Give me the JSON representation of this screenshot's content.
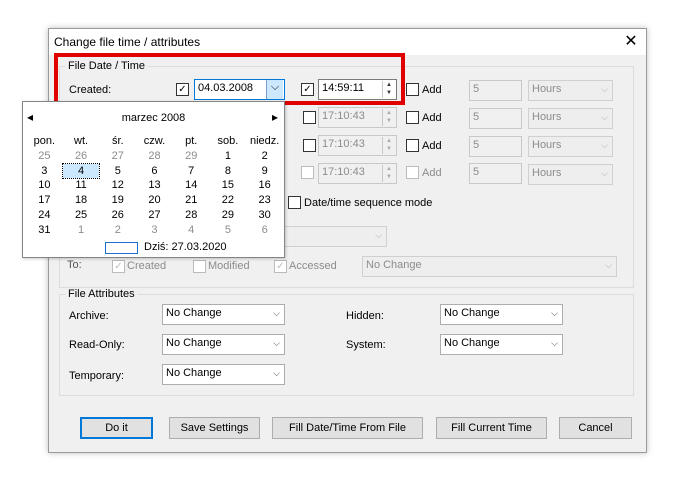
{
  "window": {
    "title": "Change file time / attributes",
    "close_glyph": "✕"
  },
  "file_date_time": {
    "group_label": "File Date / Time",
    "created": {
      "label": "Created:",
      "date": "04.03.2008",
      "time": "14:59:11",
      "add_label": "Add",
      "add_value": "5",
      "unit": "Hours"
    },
    "rows": [
      {
        "time": "17:10:43",
        "add_label": "Add",
        "add_value": "5",
        "unit": "Hours"
      },
      {
        "time": "17:10:43",
        "add_label": "Add",
        "add_value": "5",
        "unit": "Hours"
      },
      {
        "time": "17:10:43",
        "add_label": "Add",
        "add_value": "5",
        "unit": "Hours"
      }
    ],
    "sequence_mode_label": "Date/time sequence mode",
    "to": {
      "label": "To:",
      "created": "Created",
      "modified": "Modified",
      "accessed": "Accessed",
      "combo": "No Change"
    }
  },
  "calendar": {
    "month": "marzec 2008",
    "prev": "◂",
    "next": "▸",
    "weekdays": [
      "pon.",
      "wt.",
      "śr.",
      "czw.",
      "pt.",
      "sob.",
      "niedz."
    ],
    "days": [
      [
        "25",
        "26",
        "27",
        "28",
        "29",
        "1",
        "2"
      ],
      [
        "3",
        "4",
        "5",
        "6",
        "7",
        "8",
        "9"
      ],
      [
        "10",
        "11",
        "12",
        "13",
        "14",
        "15",
        "16"
      ],
      [
        "17",
        "18",
        "19",
        "20",
        "21",
        "22",
        "23"
      ],
      [
        "24",
        "25",
        "26",
        "27",
        "28",
        "29",
        "30"
      ],
      [
        "31",
        "1",
        "2",
        "3",
        "4",
        "5",
        "6"
      ]
    ],
    "today": "Dziś: 27.03.2020"
  },
  "file_attributes": {
    "group_label": "File Attributes",
    "archive": {
      "label": "Archive:",
      "value": "No Change"
    },
    "read_only": {
      "label": "Read-Only:",
      "value": "No Change"
    },
    "temporary": {
      "label": "Temporary:",
      "value": "No Change"
    },
    "hidden": {
      "label": "Hidden:",
      "value": "No Change"
    },
    "system": {
      "label": "System:",
      "value": "No Change"
    }
  },
  "buttons": {
    "do_it": "Do it",
    "save_settings": "Save Settings",
    "fill_from_file": "Fill Date/Time From File",
    "fill_current": "Fill Current Time",
    "cancel": "Cancel"
  },
  "icons": {
    "checkmark": "✓",
    "dropdown": "⌵",
    "spin_up": "▲",
    "spin_down": "▼"
  },
  "colors": {
    "highlight": "#e00000",
    "accent": "#0078d7"
  }
}
